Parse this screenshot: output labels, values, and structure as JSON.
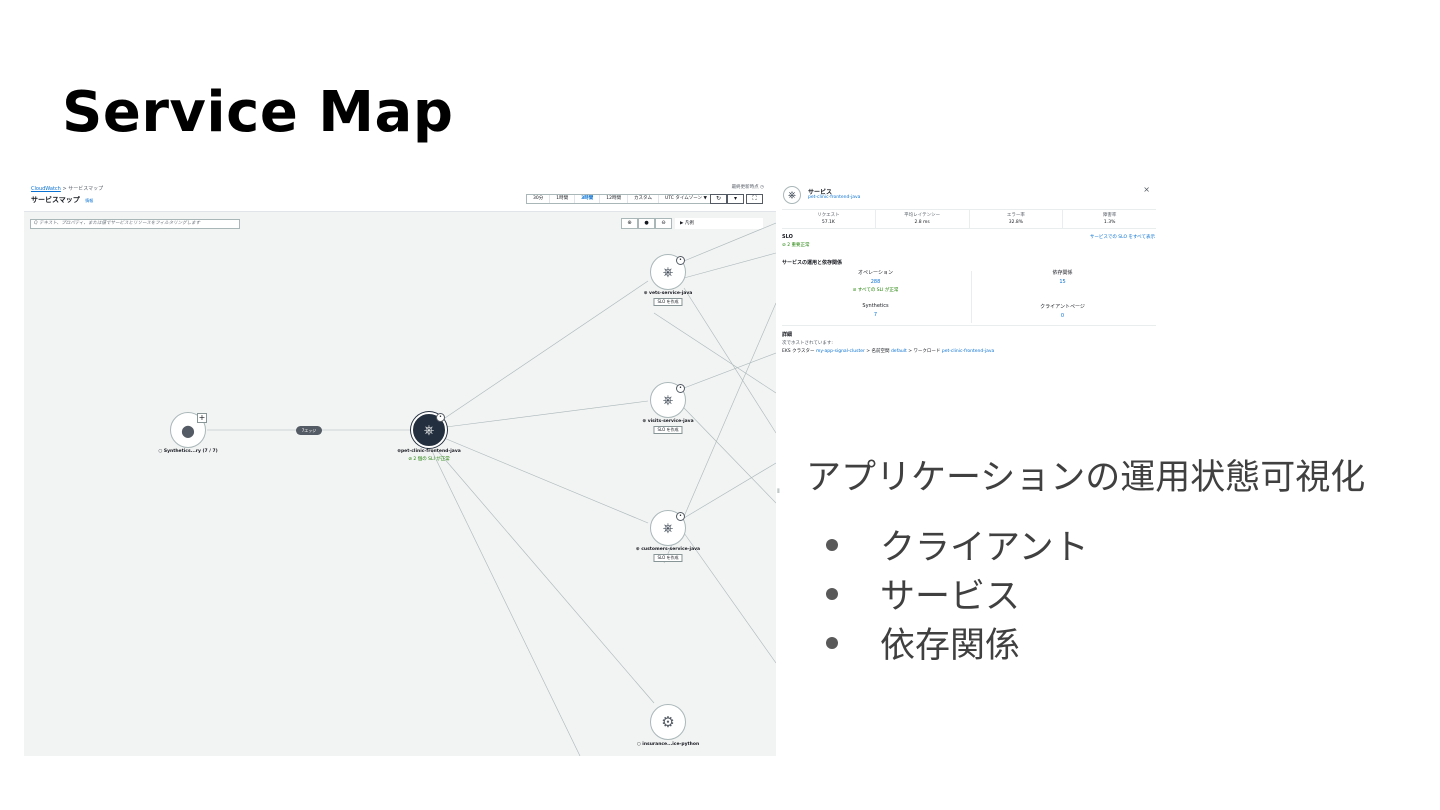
{
  "slide": {
    "title": "Service Map",
    "headline": "アプリケーションの運用状態可視化",
    "bullets": [
      "クライアント",
      "サービス",
      "依存関係"
    ]
  },
  "map": {
    "breadcrumb": [
      "CloudWatch",
      "サービスマップ"
    ],
    "title": "サービスマップ",
    "info_link": "情報",
    "last_updated": "最終更新時点 ◷",
    "time_ranges": [
      "30分",
      "1時間",
      "3時間",
      "12時間",
      "カスタム",
      "UTC タイムゾーン ▼"
    ],
    "active_time_range_index": 2,
    "refresh_icon": "refresh-icon",
    "filter_placeholder": "Q テキスト、プロパティ、または値でサービスとリソースをフィルタリングします",
    "legend_label": "▶ 凡例",
    "edge_pill": "7エッジ",
    "nodes": {
      "synthetics": "○ Synthetics...ry (7 / 7)",
      "frontend": "⊕pet-clinic-frontend-java",
      "frontend_slo": "⊘ 2 個の SLI が正常",
      "vets": "⊕ vets-service-java",
      "visits": "⊕ visits-service-java",
      "customers": "⊕ customers-service-java",
      "insurance": "○ insurance...ice-python",
      "create_slo": "SLO を作成"
    }
  },
  "panel": {
    "kind": "サービス",
    "service_name": "pet-clinic-frontend-java",
    "metrics": [
      {
        "label": "リクエスト",
        "value": "57.1K"
      },
      {
        "label": "平均レイテンシー",
        "value": "2.8 ms"
      },
      {
        "label": "エラー率",
        "value": "32.8%"
      },
      {
        "label": "障害率",
        "value": "1.3%"
      }
    ],
    "slo_heading": "SLO",
    "slo_count": "⊘ 2 重要正常",
    "slo_view_all": "サービスでの SLO をすべて表示",
    "ops_heading": "サービスの運用と依存関係",
    "cells": [
      {
        "label": "オペレーション",
        "value": "288",
        "ok": "⊘ すべての SLI が正常"
      },
      {
        "label": "依存関係",
        "value": "15"
      },
      {
        "label": "Synthetics",
        "value": "7"
      },
      {
        "label": "クライアントページ",
        "value": "0"
      }
    ],
    "details_heading": "詳細",
    "details_host": "次でホストされています:",
    "details_cluster_prefix": "EKS クラスター",
    "details_cluster": "my-app-signal-cluster",
    "details_ns_prefix": " > 名前空間",
    "details_ns": "default",
    "details_wl_prefix": " > ワークロード",
    "details_wl": "pet-clinic-frontend-java"
  }
}
